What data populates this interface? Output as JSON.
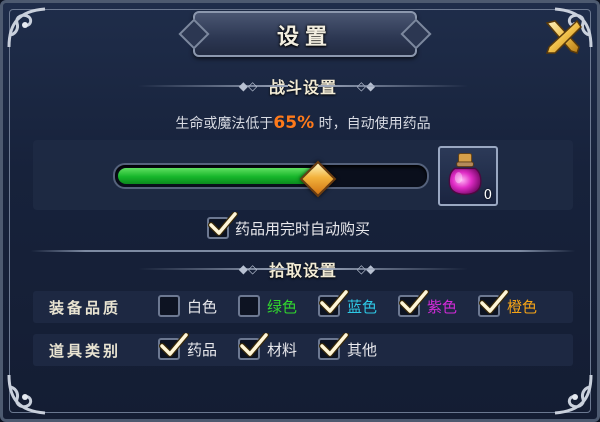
{
  "window": {
    "title": "设置"
  },
  "battle": {
    "header": "战斗设置",
    "threshold_prefix": "生命或魔法低于",
    "threshold_value": "65%",
    "threshold_suffix": " 时，自动使用药品",
    "slider_level": 0.65,
    "potion_icon": "potion-icon",
    "potion_count": "0",
    "auto_buy_label": "药品用完时自动购买",
    "auto_buy_checked": true
  },
  "pickup": {
    "header": "拾取设置",
    "quality": {
      "title": "装备品质",
      "options": [
        {
          "label": "白色",
          "checked": false,
          "color": "#e8e8ec"
        },
        {
          "label": "绿色",
          "checked": false,
          "color": "#31d72e"
        },
        {
          "label": "蓝色",
          "checked": true,
          "color": "#2ec9e6"
        },
        {
          "label": "紫色",
          "checked": true,
          "color": "#d22bd8"
        },
        {
          "label": "橙色",
          "checked": true,
          "color": "#f4a317"
        }
      ]
    },
    "category": {
      "title": "道具类别",
      "options": [
        {
          "label": "药品",
          "checked": true,
          "color": "#e8e8ec"
        },
        {
          "label": "材料",
          "checked": true,
          "color": "#e8e8ec"
        },
        {
          "label": "其他",
          "checked": true,
          "color": "#e8e8ec"
        }
      ]
    }
  },
  "colors": {
    "accent_orange": "#ff7a1a",
    "slider_green": "#16b62a",
    "panel_bg": "#17223b"
  }
}
